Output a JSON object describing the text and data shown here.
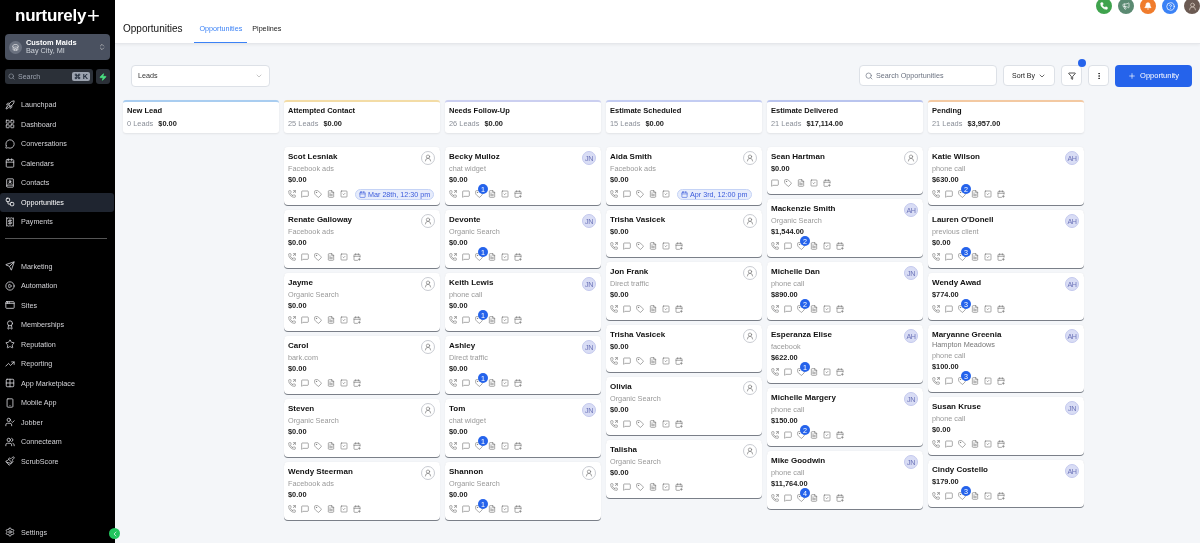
{
  "sidebar": {
    "logo": {
      "name": "nurturely",
      "mark": "+"
    },
    "account": {
      "name": "Custom Maids",
      "location": "Bay City, MI"
    },
    "search": {
      "placeholder": "Search",
      "shortcut": "⌘ K"
    },
    "nav_main": [
      {
        "label": "Launchpad",
        "selected": false
      },
      {
        "label": "Dashboard",
        "selected": false
      },
      {
        "label": "Conversations",
        "selected": false
      },
      {
        "label": "Calendars",
        "selected": false
      },
      {
        "label": "Contacts",
        "selected": false
      },
      {
        "label": "Opportunities",
        "selected": true
      },
      {
        "label": "Payments",
        "selected": false
      }
    ],
    "nav_apps": [
      {
        "label": "Marketing",
        "selected": false
      },
      {
        "label": "Automation",
        "selected": false
      },
      {
        "label": "Sites",
        "selected": false
      },
      {
        "label": "Memberships",
        "selected": false
      },
      {
        "label": "Reputation",
        "selected": false
      },
      {
        "label": "Reporting",
        "selected": false
      },
      {
        "label": "App Marketplace",
        "selected": false
      },
      {
        "label": "Mobile App",
        "selected": false
      },
      {
        "label": "Jobber",
        "selected": false
      },
      {
        "label": "Connecteam",
        "selected": false
      },
      {
        "label": "ScrubScore",
        "selected": false
      }
    ],
    "settings": "Settings"
  },
  "header": {
    "title": "Opportunities",
    "tabs": [
      {
        "label": "Opportunities",
        "selected": true
      },
      {
        "label": "Pipelines",
        "selected": false
      }
    ]
  },
  "toolbar": {
    "pipeline": "Leads",
    "search_placeholder": "Search Opportunities",
    "sort": "Sort By",
    "new_button": "Opportunity"
  },
  "columns": [
    {
      "title": "New Lead",
      "count": "0 Leads",
      "total": "$0.00",
      "color": "#a9cdf0"
    },
    {
      "title": "Attempted Contact",
      "count": "25 Leads",
      "total": "$0.00",
      "color": "#f3dca6",
      "cards": [
        {
          "name": "Scot Lesniak",
          "source": "Facebook ads",
          "amount": "$0.00",
          "avatar": {
            "kind": "user"
          },
          "appointment": "Mar 28th, 12:30 pm"
        },
        {
          "name": "Renate Galloway",
          "source": "Facebook ads",
          "amount": "$0.00",
          "avatar": {
            "kind": "user"
          }
        },
        {
          "name": "Jayme",
          "source": "Organic Search",
          "amount": "$0.00",
          "avatar": {
            "kind": "user"
          }
        },
        {
          "name": "Carol",
          "source": "bark.com",
          "amount": "$0.00",
          "avatar": {
            "kind": "user"
          }
        },
        {
          "name": "Steven",
          "source": "Organic Search",
          "amount": "$0.00",
          "avatar": {
            "kind": "user"
          }
        },
        {
          "name": "Wendy Steerman",
          "source": "Facebook ads",
          "amount": "$0.00",
          "avatar": {
            "kind": "user"
          }
        }
      ]
    },
    {
      "title": "Needs Follow-Up",
      "count": "26 Leads",
      "total": "$0.00",
      "color": "#cbcff0",
      "cards": [
        {
          "name": "Becky Mulloz",
          "source": "chat widget",
          "amount": "$0.00",
          "avatar": {
            "kind": "initials",
            "text": "JN"
          },
          "tag_count": "1"
        },
        {
          "name": "Devonte",
          "source": "Organic Search",
          "amount": "$0.00",
          "avatar": {
            "kind": "initials",
            "text": "JN"
          },
          "tag_count": "1"
        },
        {
          "name": "Keith Lewis",
          "source": "phone call",
          "amount": "$0.00",
          "avatar": {
            "kind": "initials",
            "text": "JN"
          },
          "tag_count": "1"
        },
        {
          "name": "Ashley",
          "source": "Direct traffic",
          "amount": "$0.00",
          "avatar": {
            "kind": "initials",
            "text": "JN"
          },
          "tag_count": "1"
        },
        {
          "name": "Tom",
          "source": "chat widget",
          "amount": "$0.00",
          "avatar": {
            "kind": "initials",
            "text": "JN"
          },
          "tag_count": "1"
        },
        {
          "name": "Shannon",
          "source": "Organic Search",
          "amount": "$0.00",
          "avatar": {
            "kind": "user"
          },
          "tag_count": "1"
        }
      ]
    },
    {
      "title": "Estimate Scheduled",
      "count": "15 Leads",
      "total": "$0.00",
      "color": "#c3ccf2",
      "cards": [
        {
          "name": "Aida Smith",
          "source": "Facebook ads",
          "amount": "$0.00",
          "avatar": {
            "kind": "user"
          },
          "appointment": "Apr 3rd, 12:00 pm"
        },
        {
          "name": "Trisha Vasicek",
          "amount": "$0.00",
          "avatar": {
            "kind": "user"
          }
        },
        {
          "name": "Jon Frank",
          "source": "Direct traffic",
          "amount": "$0.00",
          "avatar": {
            "kind": "user"
          }
        },
        {
          "name": "Trisha Vasicek",
          "amount": "$0.00",
          "avatar": {
            "kind": "user"
          }
        },
        {
          "name": "Olivia",
          "source": "Organic Search",
          "amount": "$0.00",
          "avatar": {
            "kind": "user"
          }
        },
        {
          "name": "Talisha",
          "source": "Organic Search",
          "amount": "$0.00",
          "avatar": {
            "kind": "user"
          }
        }
      ]
    },
    {
      "title": "Estimate Delivered",
      "count": "21 Leads",
      "total": "$17,114.00",
      "color": "#b9c4ee",
      "cards": [
        {
          "name": "Sean Hartman",
          "amount": "$0.00",
          "avatar": {
            "kind": "user"
          },
          "call": false
        },
        {
          "name": "Mackenzie Smith",
          "source": "Organic Search",
          "amount": "$1,544.00",
          "avatar": {
            "kind": "initials",
            "text": "AH"
          },
          "tag_count": "2"
        },
        {
          "name": "Michelle Dan",
          "source": "phone call",
          "amount": "$890.00",
          "avatar": {
            "kind": "initials",
            "text": "JN"
          },
          "tag_count": "2"
        },
        {
          "name": "Esperanza Elise",
          "source": "facebook",
          "amount": "$622.00",
          "avatar": {
            "kind": "initials",
            "text": "AH"
          },
          "tag_count": "1"
        },
        {
          "name": "Michelle Margery",
          "source": "phone call",
          "amount": "$150.00",
          "avatar": {
            "kind": "initials",
            "text": "JN"
          },
          "tag_count": "2"
        },
        {
          "name": "Mike Goodwin",
          "source": "phone call",
          "amount": "$11,764.00",
          "avatar": {
            "kind": "initials",
            "text": "JN"
          },
          "tag_count": "4"
        }
      ]
    },
    {
      "title": "Pending",
      "count": "21 Leads",
      "total": "$3,957.00",
      "color": "#f3c9a2",
      "cards": [
        {
          "name": "Katie Wilson",
          "source": "phone call",
          "amount": "$630.00",
          "avatar": {
            "kind": "initials",
            "text": "AH"
          },
          "tag_count": "2"
        },
        {
          "name": "Lauren O'Donell",
          "source": "previous client",
          "amount": "$0.00",
          "avatar": {
            "kind": "initials",
            "text": "AH"
          },
          "tag_count": "3"
        },
        {
          "name": "Wendy Awad",
          "amount": "$774.00",
          "avatar": {
            "kind": "initials",
            "text": "AH"
          },
          "tag_count": "3"
        },
        {
          "name": "Maryanne Greenia",
          "subtitle": "Hampton Meadows",
          "source": "phone call",
          "amount": "$100.00",
          "avatar": {
            "kind": "initials",
            "text": "AH"
          },
          "tag_count": "3"
        },
        {
          "name": "Susan Kruse",
          "source": "phone call",
          "amount": "$0.00",
          "avatar": {
            "kind": "initials",
            "text": "JN"
          }
        },
        {
          "name": "Cindy Costello",
          "amount": "$179.00",
          "avatar": {
            "kind": "initials",
            "text": "AH"
          },
          "tag_count": "3"
        }
      ]
    }
  ]
}
